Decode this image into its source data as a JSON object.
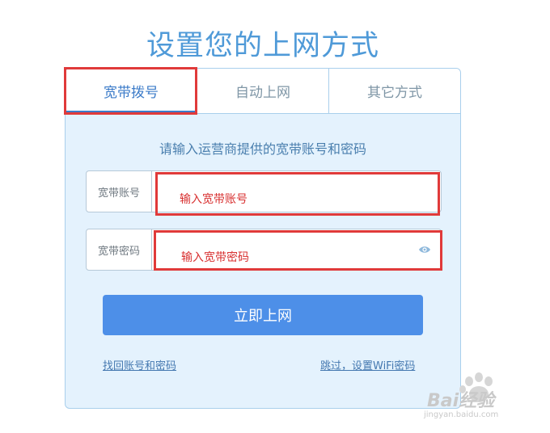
{
  "page": {
    "title": "设置您的上网方式"
  },
  "tabs": [
    {
      "label": "宽带拨号",
      "active": true
    },
    {
      "label": "自动上网",
      "active": false
    },
    {
      "label": "其它方式",
      "active": false
    }
  ],
  "form": {
    "hint": "请输入运营商提供的宽带账号和密码",
    "account": {
      "label": "宽带账号",
      "annotation": "输入宽带账号"
    },
    "password": {
      "label": "宽带密码",
      "annotation": "输入宽带密码",
      "icon": "eye-icon"
    },
    "submit_label": "立即上网",
    "recover_link": "找回账号和密码",
    "skip_link": "跳过，设置WiFi密码"
  },
  "watermark": {
    "brand": "Bai经验",
    "url": "jingyan.baidu.com"
  },
  "colors": {
    "accent": "#3d7cc9",
    "button": "#4d8fe8",
    "highlight": "#e03a3a"
  }
}
